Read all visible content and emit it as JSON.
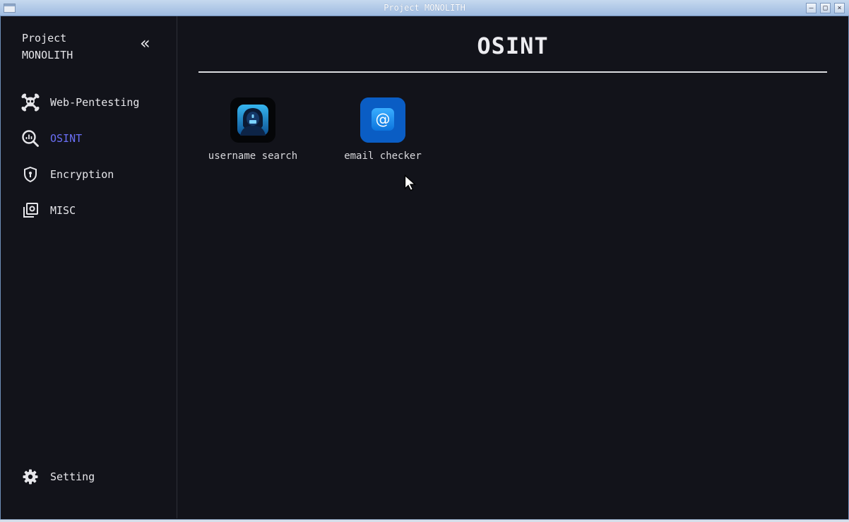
{
  "window": {
    "title": "Project MONOLITH"
  },
  "sidebar": {
    "brand_line1": "Project",
    "brand_line2": "MONOLITH",
    "collapse_icon": "double-chevron-left-icon",
    "items": [
      {
        "label": "Web-Pentesting",
        "icon": "skull-crossbones-icon",
        "active": false
      },
      {
        "label": "OSINT",
        "icon": "search-analytics-icon",
        "active": true
      },
      {
        "label": "Encryption",
        "icon": "shield-icon",
        "active": false
      },
      {
        "label": "MISC",
        "icon": "photo-library-icon",
        "active": false
      }
    ],
    "setting": {
      "label": "Setting",
      "icon": "gear-icon"
    }
  },
  "main": {
    "title": "OSINT",
    "tools": [
      {
        "label": "username search",
        "icon": "hooded-hacker-icon"
      },
      {
        "label": "email checker",
        "icon": "at-sign-icon"
      }
    ]
  },
  "colors": {
    "background": "#12131a",
    "accent": "#6a6ff5",
    "text": "#e6e6ea"
  }
}
